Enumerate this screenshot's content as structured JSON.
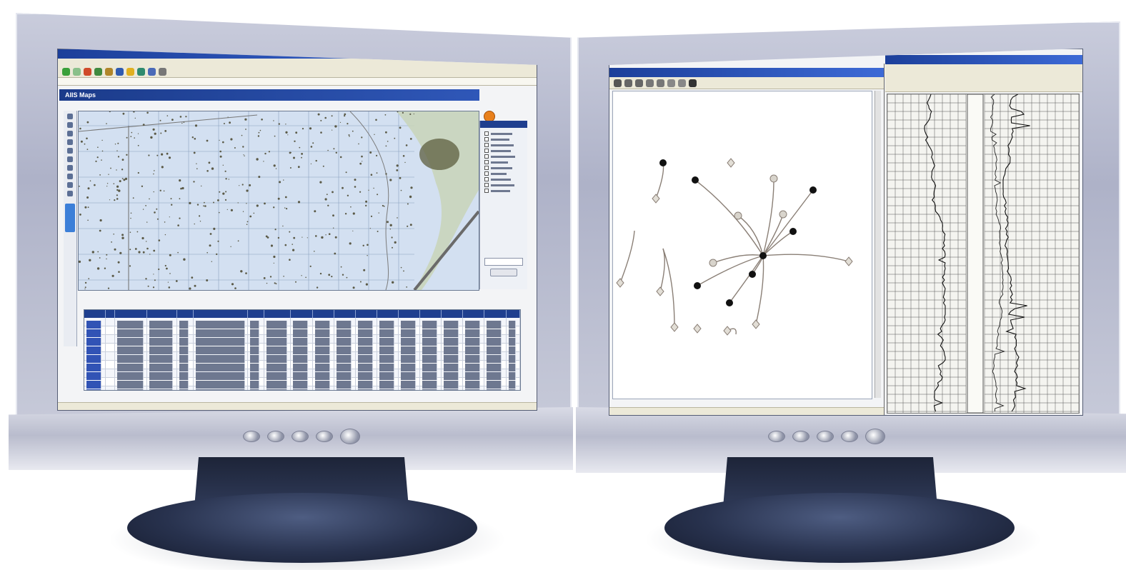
{
  "scene": {
    "left_monitor": {
      "screen": {
        "app_header_title": "AIIS Maps"
      }
    },
    "right_monitor": {
      "screen": {}
    }
  },
  "colors": {
    "titlebar": "#1c3f9a",
    "app_header": "#1b3b8a",
    "map_water": "#cfdcef",
    "well_marker": "#5b5a47",
    "node_filled": "#111111",
    "node_open": "#d8d4cc",
    "monitor_frame": "#b5b9cd",
    "monitor_base": "#28324e"
  },
  "icons": {
    "left_toolbar": [
      "back-icon",
      "forward-icon",
      "stop-icon",
      "refresh-icon",
      "home-icon",
      "search-icon",
      "favorites-icon",
      "history-icon",
      "mail-icon",
      "print-icon"
    ],
    "right_toolbar": [
      "pan-icon",
      "zoom-in-icon",
      "zoom-out-icon",
      "select-icon",
      "measure-icon",
      "print-icon",
      "save-icon",
      "help-icon"
    ]
  }
}
